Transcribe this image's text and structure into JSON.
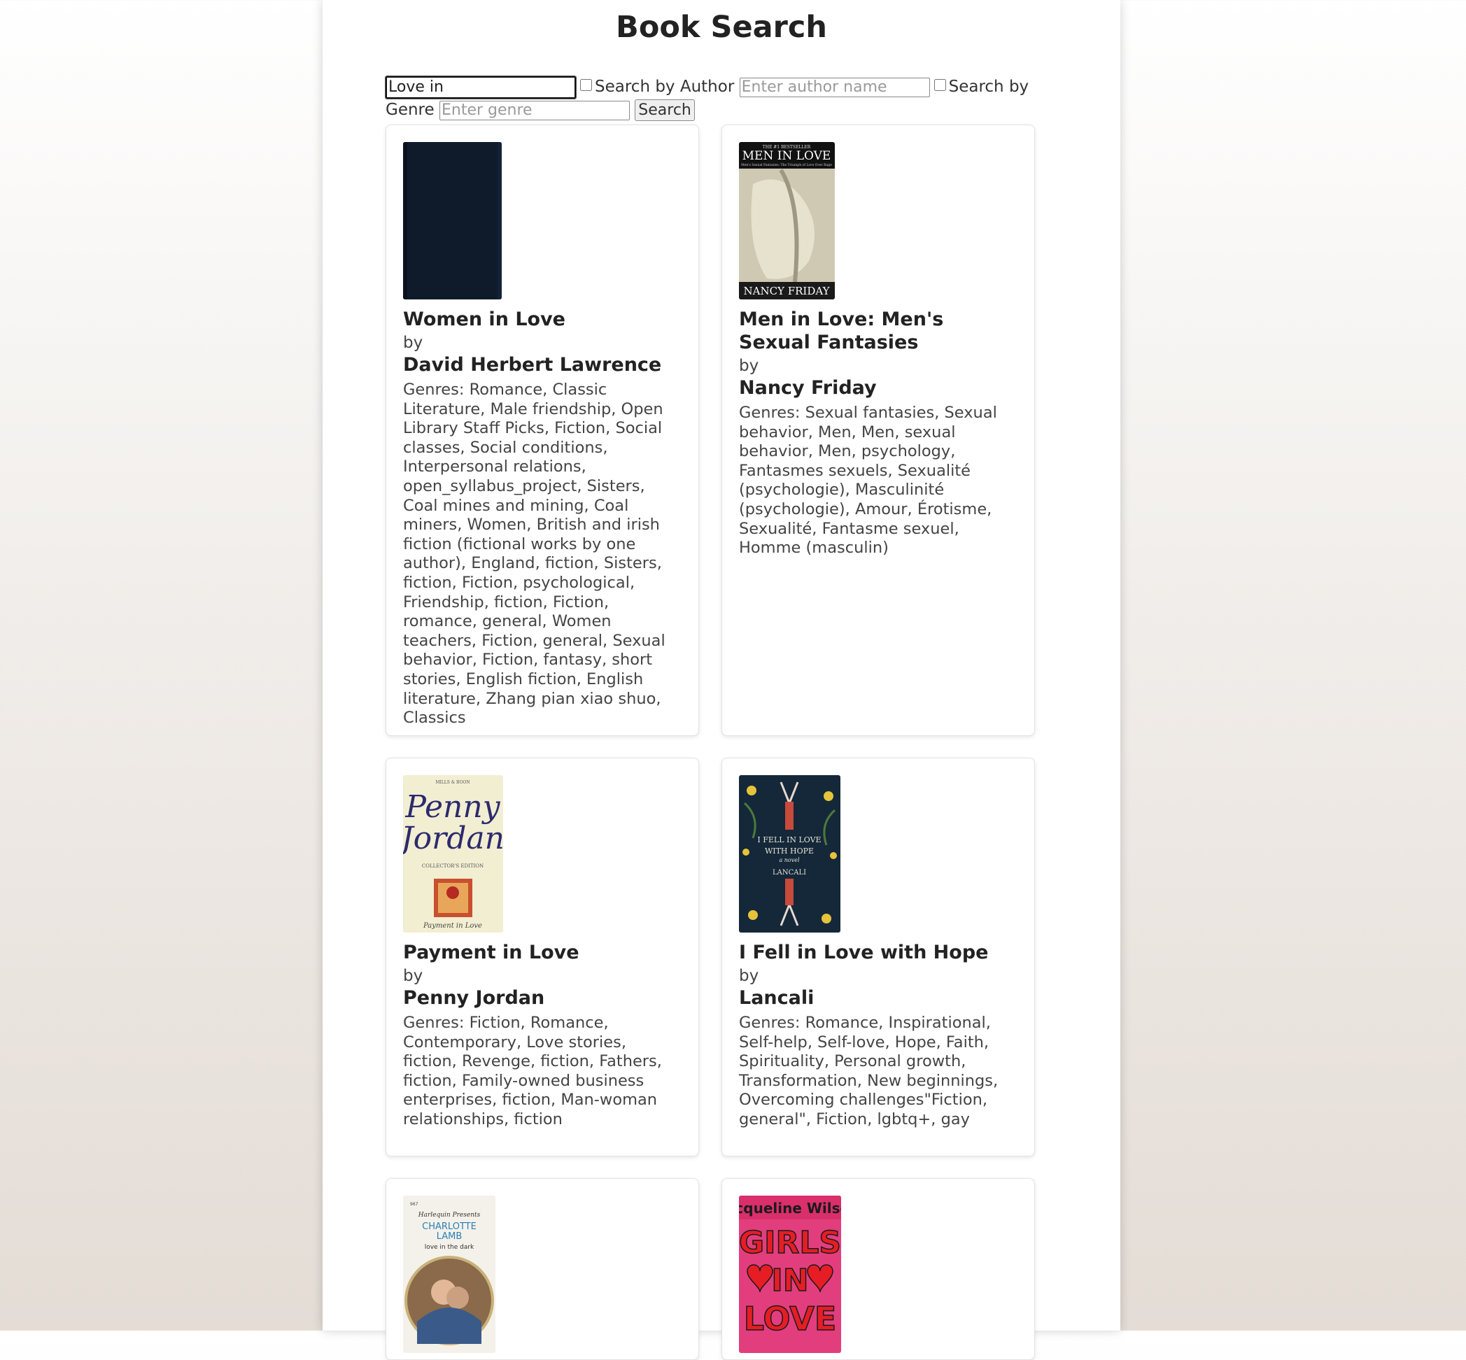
{
  "page": {
    "title": "Book Search"
  },
  "search": {
    "title_value": "Love in",
    "author_checkbox_label": "Search by Author",
    "author_placeholder": "Enter author name",
    "genre_checkbox_label_part1": "Search by",
    "genre_checkbox_label_part2": "Genre",
    "genre_placeholder": "Enter genre",
    "button_label": "Search"
  },
  "books": [
    {
      "title": "Women in Love",
      "by_label": "by",
      "author": "David Herbert Lawrence",
      "genres": "Genres: Romance, Classic Literature, Male friendship, Open Library Staff Picks, Fiction, Social classes, Social conditions, Interpersonal relations, open_syllabus_project, Sisters, Coal mines and mining, Coal miners, Women, British and irish fiction (fictional works by one author), England, fiction, Sisters, fiction, Fiction, psychological, Friendship, fiction, Fiction, romance, general, Women teachers, Fiction, general, Sexual behavior, Fiction, fantasy, short stories, English fiction, English literature, Zhang pian xiao shuo, Classics",
      "cover": {
        "type": "plain-dark",
        "bg": "#0f1a2b"
      }
    },
    {
      "title": "Men in Love: Men's Sexual Fantasies",
      "by_label": "by",
      "author": "Nancy Friday",
      "genres": "Genres: Sexual fantasies, Sexual behavior, Men, Men, sexual behavior, Men, psychology, Fantasmes sexuels, Sexualité (psychologie), Masculinité (psychologie), Amour, Érotisme, Sexualité, Fantasme sexuel, Homme (masculin)",
      "cover": {
        "type": "photo",
        "top_line": "THE #1 BESTSELLER",
        "heading": "MEN IN LOVE",
        "subtitle": "Men's Sexual Fantasies: The Triumph of Love Over Rage",
        "bottom": "NANCY FRIDAY"
      }
    },
    {
      "title": "Payment in Love",
      "by_label": "by",
      "author": "Penny Jordan",
      "genres": "Genres: Fiction, Romance, Contemporary, Love stories, fiction, Revenge, fiction, Fathers, fiction, Family-owned business enterprises, fiction, Man-woman relationships, fiction",
      "cover": {
        "type": "script",
        "publisher": "MILLS & BOON",
        "name_line1": "Penny",
        "name_line2": "Jordan",
        "edition": "COLLECTOR'S EDITION",
        "caption": "Payment in Love"
      }
    },
    {
      "title": "I Fell in Love with Hope",
      "by_label": "by",
      "author": "Lancali",
      "genres": "Genres: Romance, Inspirational, Self-help, Self-love, Hope, Faith, Spirituality, Personal growth, Transformation, New beginnings, Overcoming challenges\"Fiction, general\", Fiction, lgbtq+, gay",
      "cover": {
        "type": "floral",
        "line1": "I FELL IN LOVE",
        "line2": "WITH HOPE",
        "line3": "a novel",
        "author": "LANCALI"
      }
    },
    {
      "cover": {
        "type": "harlequin",
        "code": "967",
        "brand": "Harlequin Presents",
        "author_line1": "CHARLOTTE",
        "author_line2": "LAMB",
        "caption": "love in the dark"
      }
    },
    {
      "cover": {
        "type": "poster",
        "author": "Jacqueline Wilson",
        "word1": "GIRLS",
        "word2": "IN",
        "word3": "LOVE"
      }
    }
  ]
}
